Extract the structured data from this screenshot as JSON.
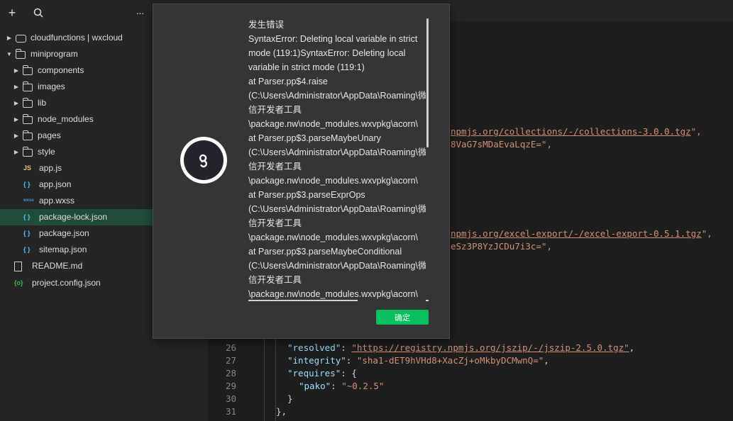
{
  "toolbar": {
    "add_icon": "+",
    "search_icon": "search-icon",
    "more_icon": "···"
  },
  "tree": [
    {
      "label": "cloudfunctions | wxcloud",
      "kind": "cloud",
      "arrow": "▶"
    },
    {
      "label": "miniprogram",
      "kind": "folder",
      "arrow": "▼"
    },
    {
      "label": "components",
      "kind": "folder",
      "arrow": "▶"
    },
    {
      "label": "images",
      "kind": "folder",
      "arrow": "▶"
    },
    {
      "label": "lib",
      "kind": "folder",
      "arrow": "▶"
    },
    {
      "label": "node_modules",
      "kind": "folder",
      "arrow": "▶"
    },
    {
      "label": "pages",
      "kind": "folder",
      "arrow": "▶"
    },
    {
      "label": "style",
      "kind": "folder",
      "arrow": "▶"
    },
    {
      "label": "app.js",
      "kind": "js",
      "icon_text": "JS",
      "icon_color": "#e5c07b"
    },
    {
      "label": "app.json",
      "kind": "json",
      "icon_text": "{ }",
      "icon_color": "#4fc1ff"
    },
    {
      "label": "app.wxss",
      "kind": "wxss",
      "icon_text": "wxss",
      "icon_color": "#4a90e2"
    },
    {
      "label": "package-lock.json",
      "kind": "json",
      "icon_text": "{ }",
      "icon_color": "#4fc1ff",
      "active": true
    },
    {
      "label": "package.json",
      "kind": "json",
      "icon_text": "{ }",
      "icon_color": "#4fc1ff"
    },
    {
      "label": "sitemap.json",
      "kind": "json",
      "icon_text": "{ }",
      "icon_color": "#4fc1ff"
    },
    {
      "label": "README.md",
      "kind": "file"
    },
    {
      "label": "project.config.json",
      "kind": "config",
      "icon_text": "{o}",
      "icon_color": "#3fb950"
    }
  ],
  "code": {
    "partial": [
      {
        "text": "npmjs.org/collections/-/collections-3.0.0.tgz",
        "tail": "\","
      },
      {
        "text": "8VaG7sMDaEvaLqzE=\",",
        "tail": ""
      },
      {
        "text": "npmjs.org/excel-export/-/excel-export-0.5.1.tgz",
        "tail": "\","
      },
      {
        "text": "eSz3P8YzJCDu7i3c=\",",
        "tail": ""
      }
    ],
    "lines": [
      {
        "num": "26",
        "key": "\"resolved\"",
        "sep": ": ",
        "val": "\"https://registry.npmjs.org/jszip/-/jszip-2.5.0.tgz\"",
        "end": ","
      },
      {
        "num": "27",
        "key": "\"integrity\"",
        "sep": ": ",
        "val": "\"sha1-dET9hVHd8+XacZj+oMkbyDCMwnQ=\"",
        "end": ","
      },
      {
        "num": "28",
        "key": "\"requires\"",
        "sep": ": ",
        "val": "",
        "end": "{"
      },
      {
        "num": "29",
        "key": "\"pako\"",
        "sep": ": ",
        "val": "\"~0.2.5\"",
        "end": ""
      },
      {
        "num": "30",
        "key": "",
        "sep": "",
        "val": "",
        "end": "}"
      },
      {
        "num": "31",
        "key": "",
        "sep": "",
        "val": "",
        "end": "},"
      }
    ]
  },
  "dialog": {
    "lines": [
      "发生错误",
      "SyntaxError: Deleting local variable in strict",
      "mode (119:1)SyntaxError: Deleting local",
      "variable in strict mode (119:1)",
      "at Parser.pp$4.raise",
      "(C:\\Users\\Administrator\\AppData\\Roaming\\微",
      "信开发者工具",
      "\\package.nw\\node_modules.wxvpkg\\acorn\\",
      "at Parser.pp$3.parseMaybeUnary",
      "(C:\\Users\\Administrator\\AppData\\Roaming\\微",
      "信开发者工具",
      "\\package.nw\\node_modules.wxvpkg\\acorn\\",
      "at Parser.pp$3.parseExprOps",
      "(C:\\Users\\Administrator\\AppData\\Roaming\\微",
      "信开发者工具",
      "\\package.nw\\node_modules.wxvpkg\\acorn\\",
      "at Parser.pp$3.parseMaybeConditional",
      "(C:\\Users\\Administrator\\AppData\\Roaming\\微",
      "信开发者工具",
      "\\package.nw\\node_modules.wxvpkg\\acorn\\"
    ],
    "ok_label": "确定",
    "accent": "#07c160"
  }
}
